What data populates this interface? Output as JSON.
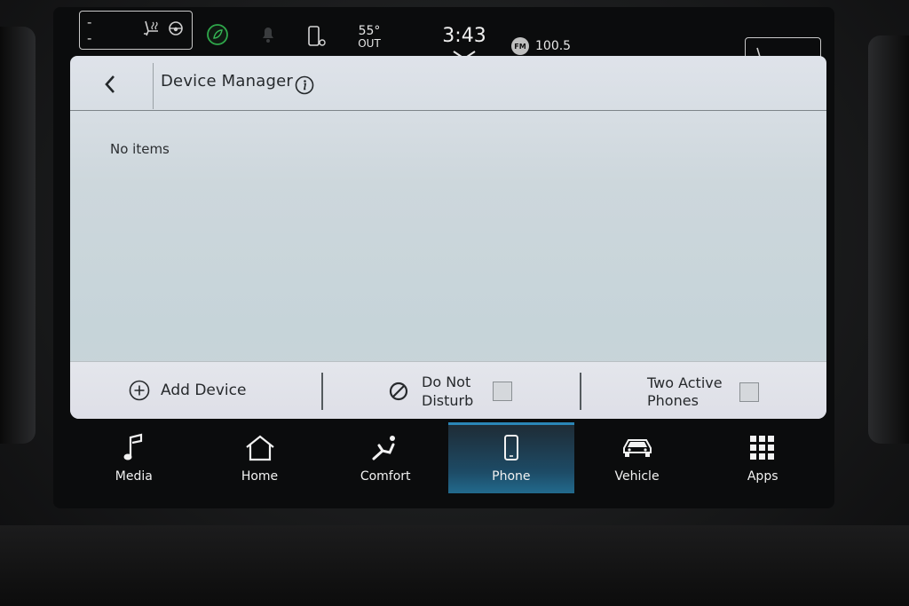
{
  "status_bar": {
    "left_climate_value": "--",
    "right_climate_value": "--",
    "outside_temp": "55°",
    "outside_label": "OUT",
    "time": "3:43",
    "radio_band": "FM",
    "radio_frequency": "100.5"
  },
  "header": {
    "title": "Device Manager"
  },
  "device_list": {
    "empty_text": "No items"
  },
  "actions": {
    "add_device": "Add Device",
    "do_not_disturb_line1": "Do Not",
    "do_not_disturb_line2": "Disturb",
    "do_not_disturb_checked": false,
    "two_active_line1": "Two Active",
    "two_active_line2": "Phones",
    "two_active_checked": false
  },
  "nav": {
    "items": [
      {
        "label": "Media",
        "icon": "music-note-icon"
      },
      {
        "label": "Home",
        "icon": "home-icon"
      },
      {
        "label": "Comfort",
        "icon": "seat-icon"
      },
      {
        "label": "Phone",
        "icon": "phone-icon",
        "active": true
      },
      {
        "label": "Vehicle",
        "icon": "car-icon"
      },
      {
        "label": "Apps",
        "icon": "apps-grid-icon"
      }
    ]
  },
  "colors": {
    "active_tab": "#1d4b66",
    "panel_background": "#cdd7dc"
  }
}
